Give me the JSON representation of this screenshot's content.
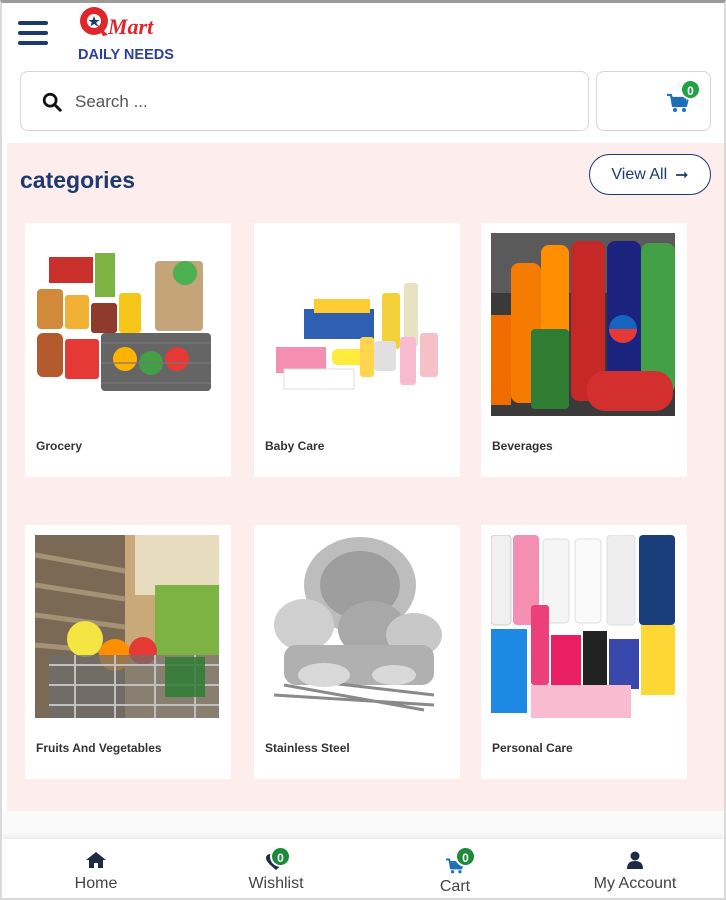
{
  "brand": {
    "name_top": "Mart",
    "name_bottom": "DAILY NEEDS"
  },
  "search": {
    "placeholder": "Search ..."
  },
  "header_cart": {
    "count": "0"
  },
  "categories": {
    "title": "categories",
    "view_all_label": "View All",
    "items": [
      {
        "label": "Grocery"
      },
      {
        "label": "Baby Care"
      },
      {
        "label": "Beverages"
      },
      {
        "label": "Fruits And Vegetables"
      },
      {
        "label": "Stainless Steel"
      },
      {
        "label": "Personal Care"
      }
    ]
  },
  "bottom_nav": {
    "home": {
      "label": "Home",
      "icon": "home-icon"
    },
    "wishlist": {
      "label": "Wishlist",
      "icon": "heart-icon",
      "count": "0"
    },
    "cart": {
      "label": "Cart",
      "icon": "cart-icon",
      "count": "0"
    },
    "account": {
      "label": "My Account",
      "icon": "user-icon"
    }
  },
  "colors": {
    "brand_navy": "#1d3a6e",
    "brand_red": "#e0262c",
    "badge_green": "#1b8a3a",
    "section_bg": "#fdeded"
  }
}
